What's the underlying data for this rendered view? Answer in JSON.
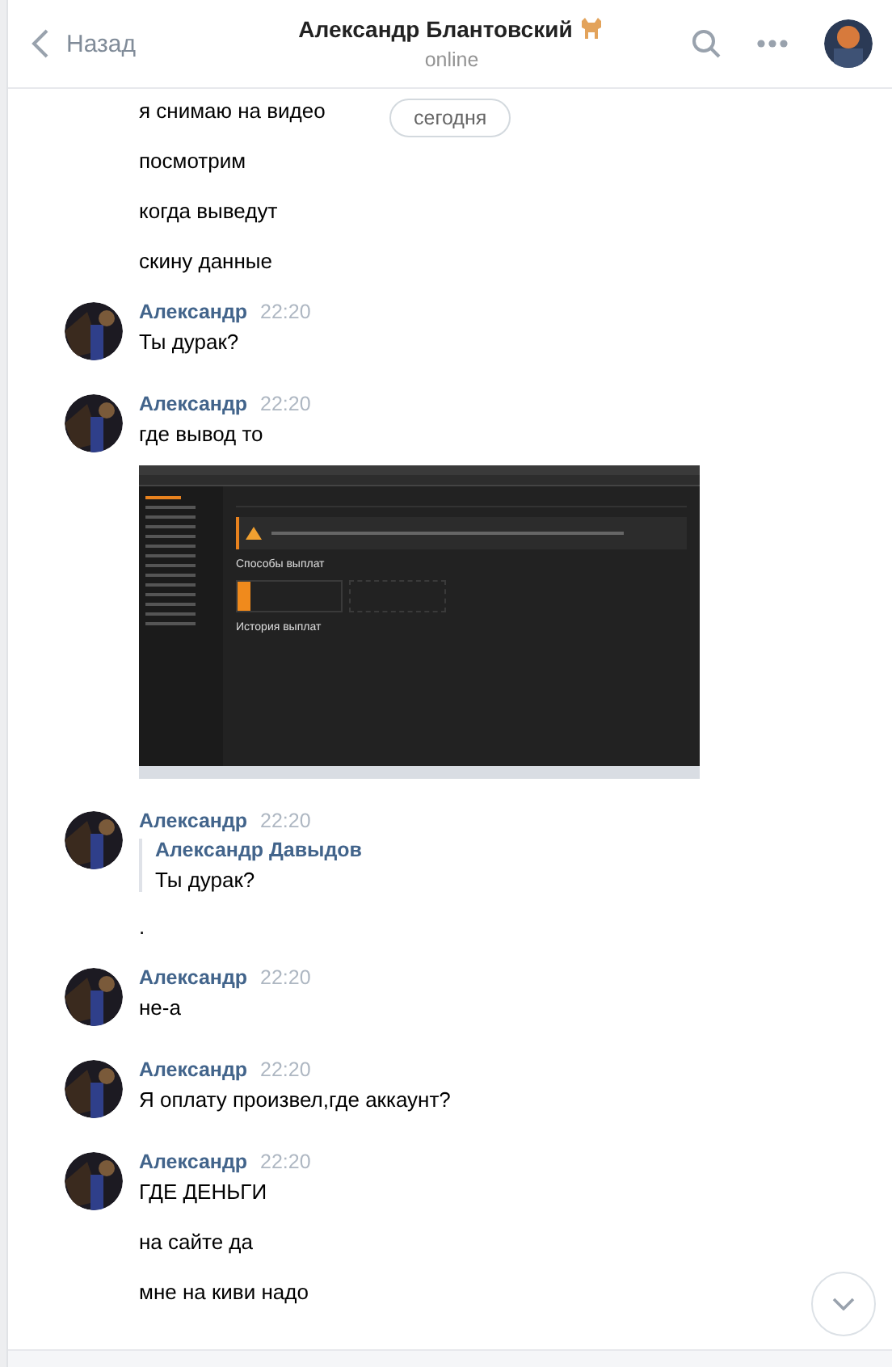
{
  "header": {
    "back_label": "Назад",
    "title": "Александр Блантовский",
    "status": "online"
  },
  "date_label": "сегодня",
  "groups": [
    {
      "items": [
        {
          "kind": "text",
          "text": "я снимаю на видео"
        },
        {
          "kind": "text",
          "text": "посмотрим"
        },
        {
          "kind": "text",
          "text": "когда выведут"
        },
        {
          "kind": "text",
          "text": "скину данные"
        }
      ]
    },
    {
      "author": "Александр",
      "time": "22:20",
      "items": [
        {
          "kind": "text",
          "text": "Ты дурак?"
        }
      ]
    },
    {
      "author": "Александр",
      "time": "22:20",
      "items": [
        {
          "kind": "text",
          "text": "где вывод то"
        },
        {
          "kind": "screenshot",
          "heading": "Способы выплат",
          "subheading": "История выплат"
        }
      ]
    },
    {
      "author": "Александр",
      "time": "22:20",
      "items": [
        {
          "kind": "reply",
          "author": "Александр Давыдов",
          "text": "Ты дурак?"
        },
        {
          "kind": "text",
          "text": "."
        }
      ]
    },
    {
      "author": "Александр",
      "time": "22:20",
      "items": [
        {
          "kind": "text",
          "text": "не-а"
        }
      ]
    },
    {
      "author": "Александр",
      "time": "22:20",
      "items": [
        {
          "kind": "text",
          "text": "Я оплату произвел,где аккаунт?"
        }
      ]
    },
    {
      "author": "Александр",
      "time": "22:20",
      "items": [
        {
          "kind": "text",
          "text": "ГДЕ ДЕНЬГИ"
        },
        {
          "kind": "text",
          "text": "на сайте да"
        },
        {
          "kind": "text",
          "text": "мне на киви надо"
        }
      ]
    }
  ]
}
